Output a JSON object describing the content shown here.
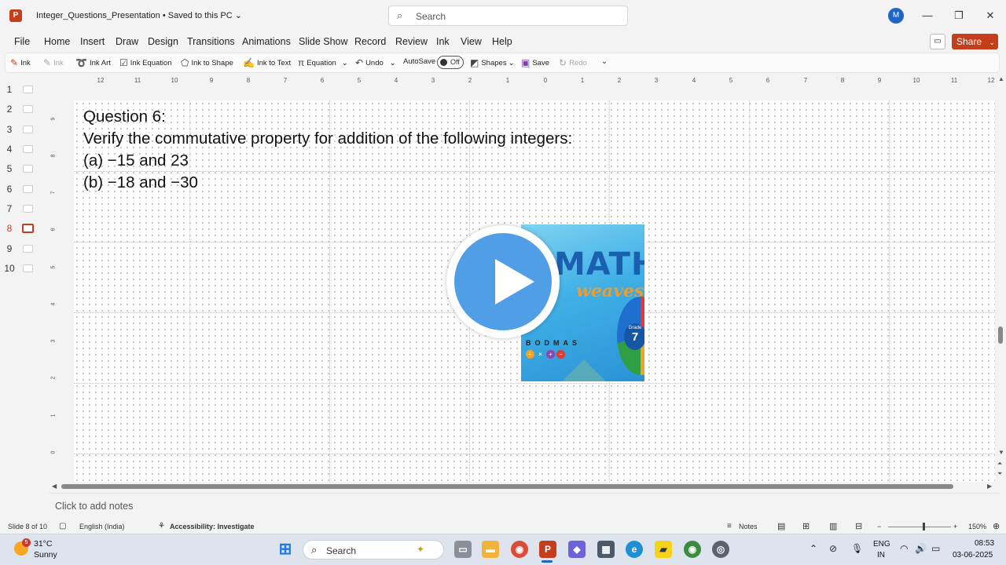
{
  "window": {
    "logo": "P",
    "title": "Integer_Questions_Presentation • Saved to this PC ⌄",
    "search_placeholder": "Search",
    "avatar": "M",
    "minimize": "—",
    "restore": "❐",
    "close": "✕"
  },
  "menu": {
    "items": [
      "File",
      "Home",
      "Insert",
      "Draw",
      "Design",
      "Transitions",
      "Animations",
      "Slide Show",
      "Record",
      "Review",
      "Ink",
      "View",
      "Help"
    ],
    "comment_icon": "▭",
    "share_label": "Share",
    "share_caret": "⌄"
  },
  "ribbon": {
    "ink": "Ink",
    "ink_disabled": "Ink",
    "ink_art": "Ink Art",
    "ink_equation": "Ink Equation",
    "ink_to_shape": "Ink to Shape",
    "ink_to_text": "Ink to Text",
    "equation": "Equation",
    "equation_caret": "⌄",
    "undo": "Undo",
    "undo_caret": "⌄",
    "autosave": "AutoSave",
    "autosave_state": "Off",
    "shapes": "Shapes",
    "shapes_caret": "⌄",
    "save": "Save",
    "redo": "Redo",
    "more": "⌄"
  },
  "thumbnails": [
    "1",
    "2",
    "3",
    "4",
    "5",
    "6",
    "7",
    "8",
    "9",
    "10"
  ],
  "active_slide": 8,
  "ruler": {
    "horizontal": [
      "12",
      "11",
      "10",
      "9",
      "8",
      "7",
      "6",
      "5",
      "4",
      "3",
      "2",
      "1",
      "0",
      "1",
      "2",
      "3",
      "4",
      "5",
      "6",
      "7",
      "8",
      "9",
      "10",
      "11",
      "12"
    ],
    "vertical": [
      "9",
      "8",
      "7",
      "6",
      "5",
      "4",
      "3",
      "2",
      "1",
      "0"
    ]
  },
  "slide": {
    "lines": [
      "Question 6:",
      "Verify the commutative property for addition of the following integers:",
      "(a) −15 and 23",
      "(b) −18 and −30"
    ],
    "book_title": "MATHS",
    "book_subtitle": "weaves",
    "book_grade_label": "Grade",
    "book_grade": "7",
    "book_bodmas": "BODMAS",
    "book_ops": [
      "÷",
      "×",
      "+",
      "−"
    ]
  },
  "notes": {
    "placeholder": "Click to add notes"
  },
  "status": {
    "slide_counter": "Slide 8 of 10",
    "language": "English (India)",
    "accessibility": "Accessibility: Investigate",
    "notes_label": "Notes",
    "zoom_minus": "−",
    "zoom_plus": "+",
    "zoom": "150%"
  },
  "taskbar": {
    "weather_badge": "5",
    "temperature": "31°C",
    "condition": "Sunny",
    "search": "Search",
    "lang_top": "ENG",
    "lang_bottom": "IN",
    "time": "08:53",
    "date": "03-06-2025"
  },
  "colors": {
    "accent": "#c43e1c",
    "play_button": "#4f9ee6"
  }
}
